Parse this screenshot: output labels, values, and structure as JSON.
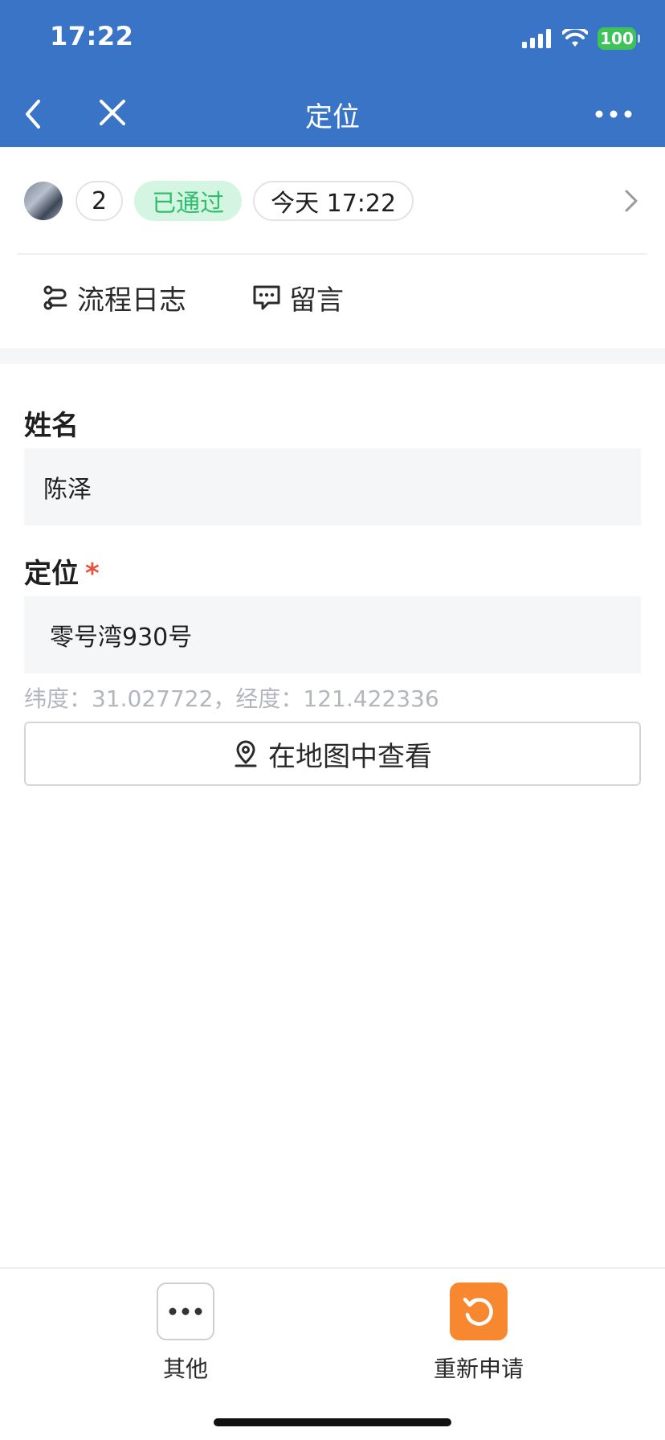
{
  "colors": {
    "brand": "#3a74c6",
    "approved_text": "#2fbf6c",
    "approved_bg": "#d5f5e3",
    "required": "#e5533d",
    "accent_orange": "#f7882f"
  },
  "status_bar": {
    "time": "17:22",
    "battery": "100",
    "icons": [
      "signal-icon",
      "wifi-icon",
      "battery-icon"
    ]
  },
  "nav": {
    "title": "定位",
    "back_icon": "chevron-left-icon",
    "close_icon": "close-icon",
    "more_icon": "more-dots-icon"
  },
  "approval": {
    "count": "2",
    "status": "已通过",
    "time": "今天 17:22"
  },
  "actions": {
    "log_label": "流程日志",
    "comment_label": "留言"
  },
  "form": {
    "name_label": "姓名",
    "name_value": "陈泽",
    "location_label": "定位",
    "required_mark": "*",
    "location_value": "零号湾930号",
    "coords_text": "纬度：31.027722，经度：121.422336",
    "map_button_label": "在地图中查看"
  },
  "bottom_bar": {
    "other_label": "其他",
    "reapply_label": "重新申请"
  }
}
